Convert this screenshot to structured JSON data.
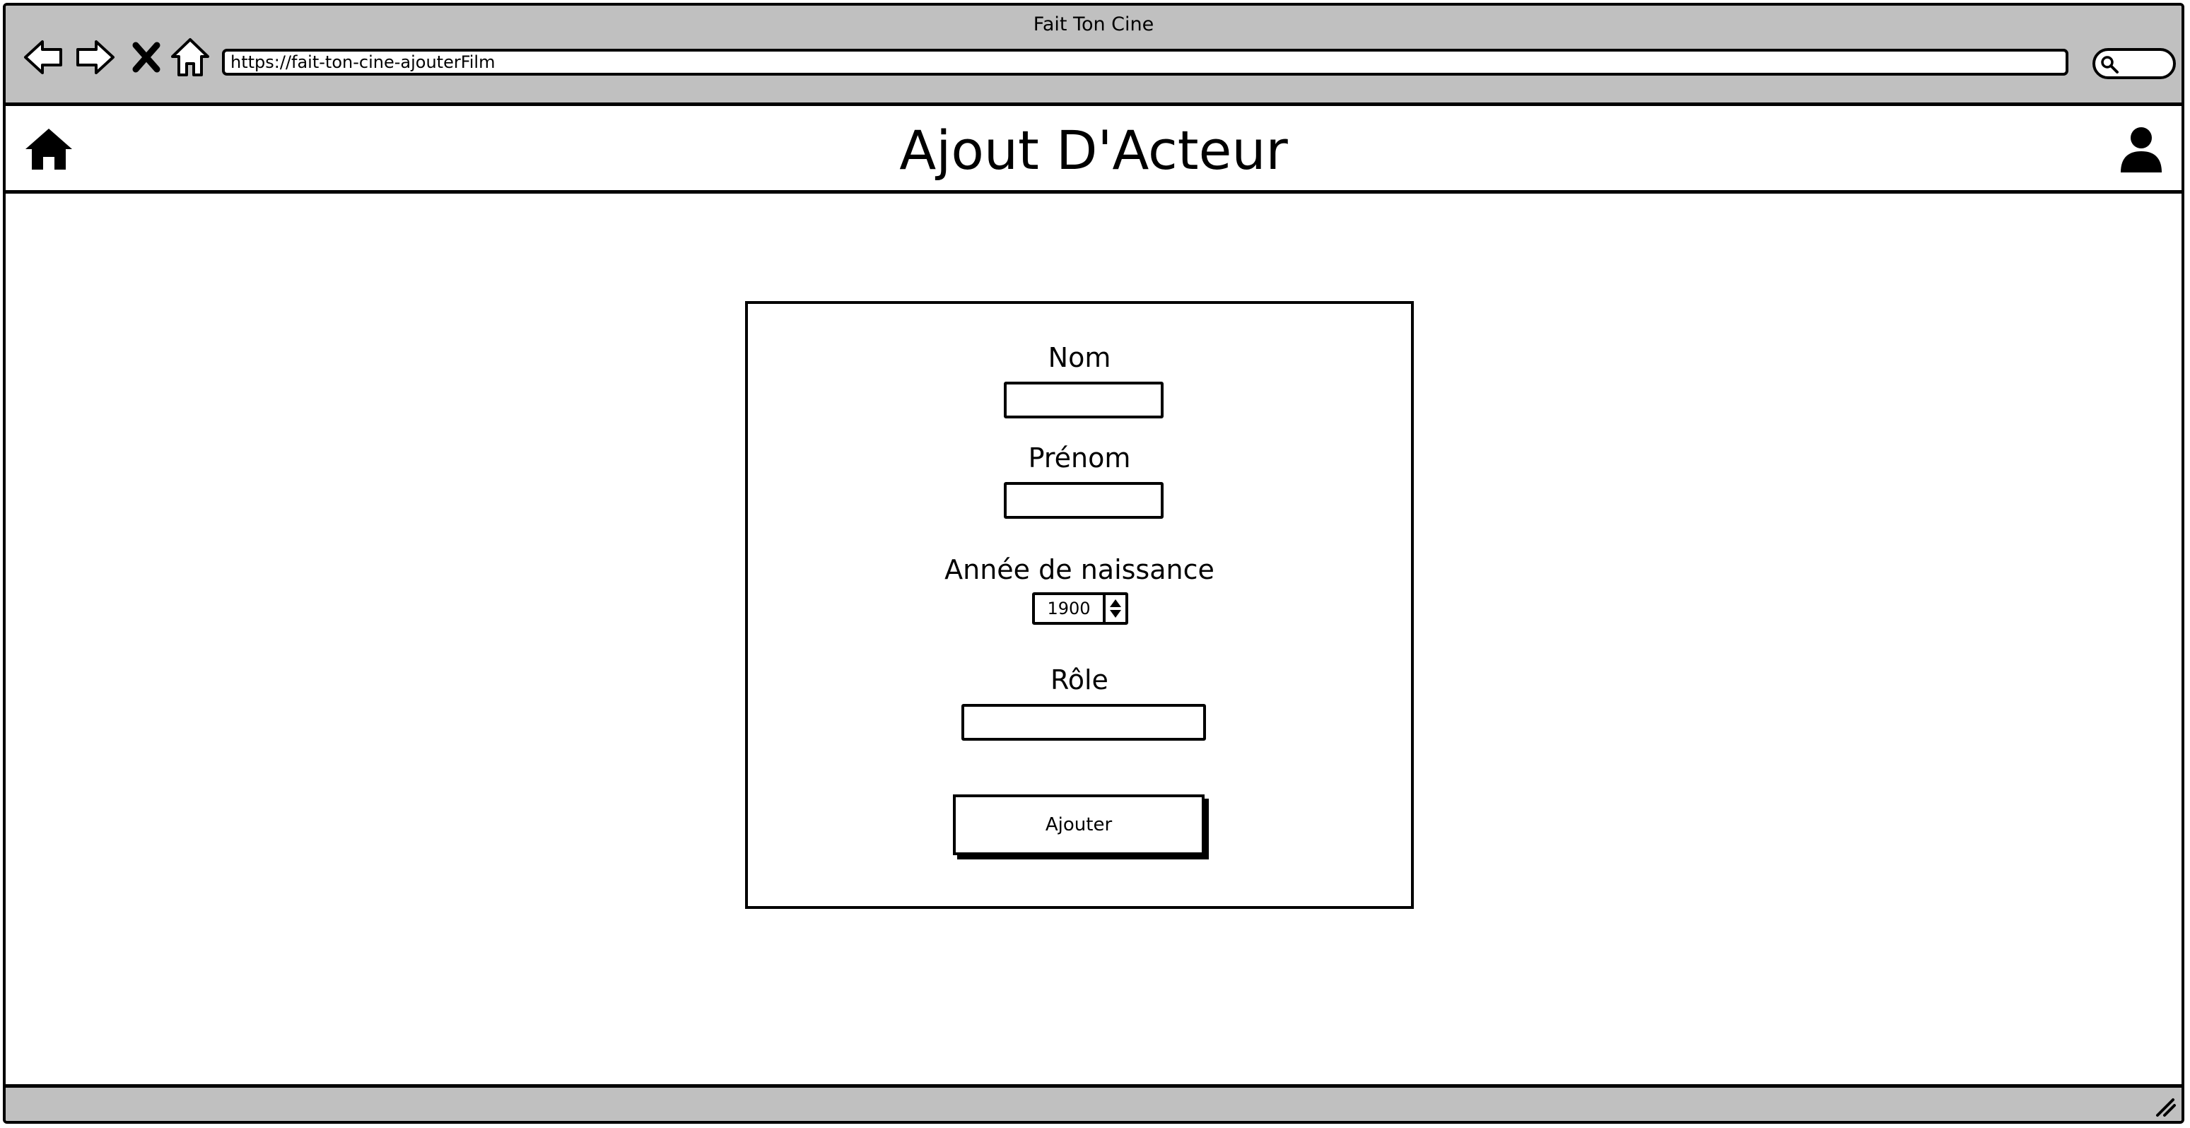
{
  "browser": {
    "window_title": "Fait Ton Cine",
    "url": "https://fait-ton-cine-ajouterFilm",
    "nav_icons": [
      "back-arrow-icon",
      "forward-arrow-icon",
      "stop-icon",
      "home-icon"
    ],
    "search_icon": "magnifier-icon"
  },
  "header": {
    "title": "Ajout D'Acteur",
    "left_icon": "home-icon",
    "right_icon": "user-icon"
  },
  "form": {
    "fields": [
      {
        "label": "Nom",
        "value": ""
      },
      {
        "label": "Prénom",
        "value": ""
      },
      {
        "label": "Année de naissance",
        "value": "1900"
      },
      {
        "label": "Rôle",
        "value": ""
      }
    ],
    "submit_label": "Ajouter"
  },
  "colors": {
    "chrome": "#c0c0c0",
    "stroke": "#000000",
    "background": "#ffffff"
  }
}
